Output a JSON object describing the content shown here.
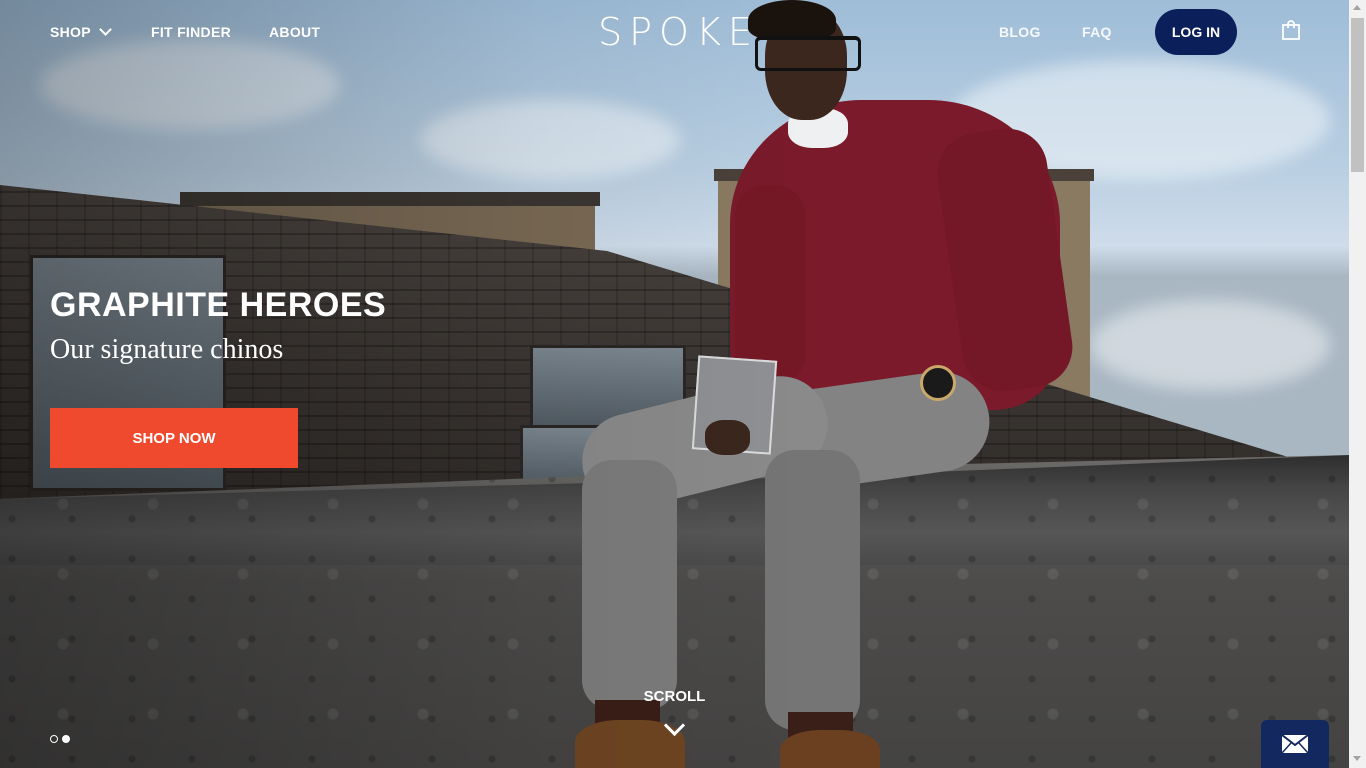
{
  "header": {
    "logo": "SPOKE",
    "nav_left": [
      {
        "label": "SHOP",
        "has_dropdown": true,
        "icon": "chevron-down-icon"
      },
      {
        "label": "FIT FINDER"
      },
      {
        "label": "ABOUT"
      }
    ],
    "nav_right": [
      {
        "label": "BLOG"
      },
      {
        "label": "FAQ"
      }
    ],
    "login_label": "LOG IN",
    "cart_icon": "shopping-bag-icon"
  },
  "hero": {
    "title": "GRAPHITE HEROES",
    "subtitle": "Our signature chinos",
    "cta_label": "SHOP NOW",
    "scroll_label": "SCROLL",
    "scroll_icon": "chevron-down-icon",
    "carousel": {
      "slides": 2,
      "active_index": 1
    }
  },
  "footer_widget": {
    "icon": "envelope-icon"
  },
  "colors": {
    "login_bg": "#0b1f5a",
    "cta_bg": "#f04a2e",
    "mail_bg": "#13285f",
    "text": "#ffffff"
  }
}
